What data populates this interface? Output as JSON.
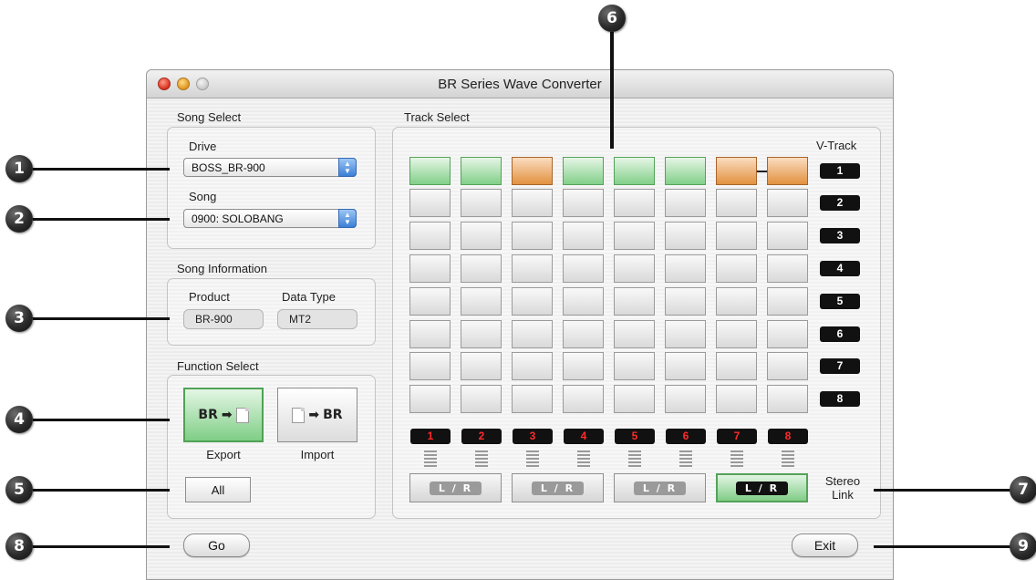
{
  "window": {
    "title": "BR Series Wave Converter"
  },
  "song_select": {
    "group_label": "Song Select",
    "drive_label": "Drive",
    "drive_value": "BOSS_BR-900",
    "song_label": "Song",
    "song_value": "0900: SOLOBANG"
  },
  "song_info": {
    "group_label": "Song Information",
    "product_label": "Product",
    "product_value": "BR-900",
    "data_type_label": "Data Type",
    "data_type_value": "MT2"
  },
  "function_select": {
    "group_label": "Function Select",
    "export_glyph": "BR",
    "export_label": "Export",
    "import_glyph": "BR",
    "import_label": "Import",
    "all_label": "All"
  },
  "track_select": {
    "group_label": "Track Select",
    "vtrack_header": "V-Track",
    "vtracks": [
      "1",
      "2",
      "3",
      "4",
      "5",
      "6",
      "7",
      "8"
    ],
    "tracks": [
      "1",
      "2",
      "3",
      "4",
      "5",
      "6",
      "7",
      "8"
    ],
    "first_row_states": [
      "green",
      "green",
      "orange",
      "green",
      "green",
      "green",
      "orange",
      "orange"
    ],
    "stereo_buttons": [
      {
        "label": "L / R",
        "on": false
      },
      {
        "label": "L / R",
        "on": false
      },
      {
        "label": "L / R",
        "on": false
      },
      {
        "label": "L / R",
        "on": true
      }
    ],
    "stereo_link_label_line1": "Stereo",
    "stereo_link_label_line2": "Link"
  },
  "buttons": {
    "go": "Go",
    "exit": "Exit"
  },
  "callouts": [
    "1",
    "2",
    "3",
    "4",
    "5",
    "6",
    "7",
    "8",
    "9"
  ],
  "colors": {
    "selected_green": "#82cf89",
    "selected_orange": "#e2913f",
    "callout": "#2a2a2a"
  }
}
